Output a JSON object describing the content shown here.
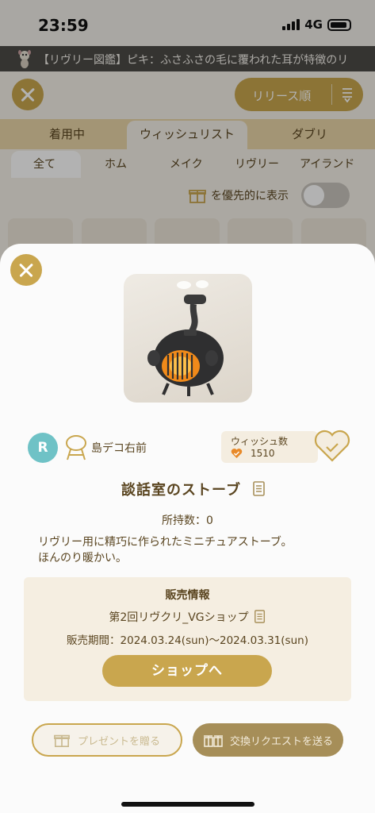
{
  "status_bar": {
    "time": "23:59",
    "network": "4G"
  },
  "ticker": {
    "text": "【リヴリー図鑑】ピキ：ふさふさの毛に覆われた耳が特徴のリ"
  },
  "background": {
    "sort_label": "リリース順",
    "tabs": [
      "着用中",
      "ウィッシュリスト",
      "ダブリ"
    ],
    "subtabs": [
      "全て",
      "ホム",
      "メイク",
      "リヴリー",
      "アイランド"
    ],
    "priority_label": "を優先的に表示"
  },
  "item": {
    "creator_initial": "R",
    "creator_name": "島デコ右前",
    "wish_label": "ウィッシュ数",
    "wish_count": "1510",
    "title": "談話室のストーブ",
    "owned": "所持数：0",
    "description_line1": "リヴリー用に精巧に作られたミニチュアストーブ。",
    "description_line2": "ほんのり暖かい。"
  },
  "sale": {
    "title": "販売情報",
    "shop_name": "第2回リヴクリ_VGショップ",
    "period": "販売期間：2024.03.24(sun)〜2024.03.31(sun)",
    "shop_button": "ショップへ"
  },
  "actions": {
    "gift": "プレゼントを贈る",
    "trade": "交換リクエストを送る"
  },
  "colors": {
    "accent": "#c9a64e",
    "creator_avatar": "#6fc2c6",
    "stove_glow": "#f08a1a"
  }
}
